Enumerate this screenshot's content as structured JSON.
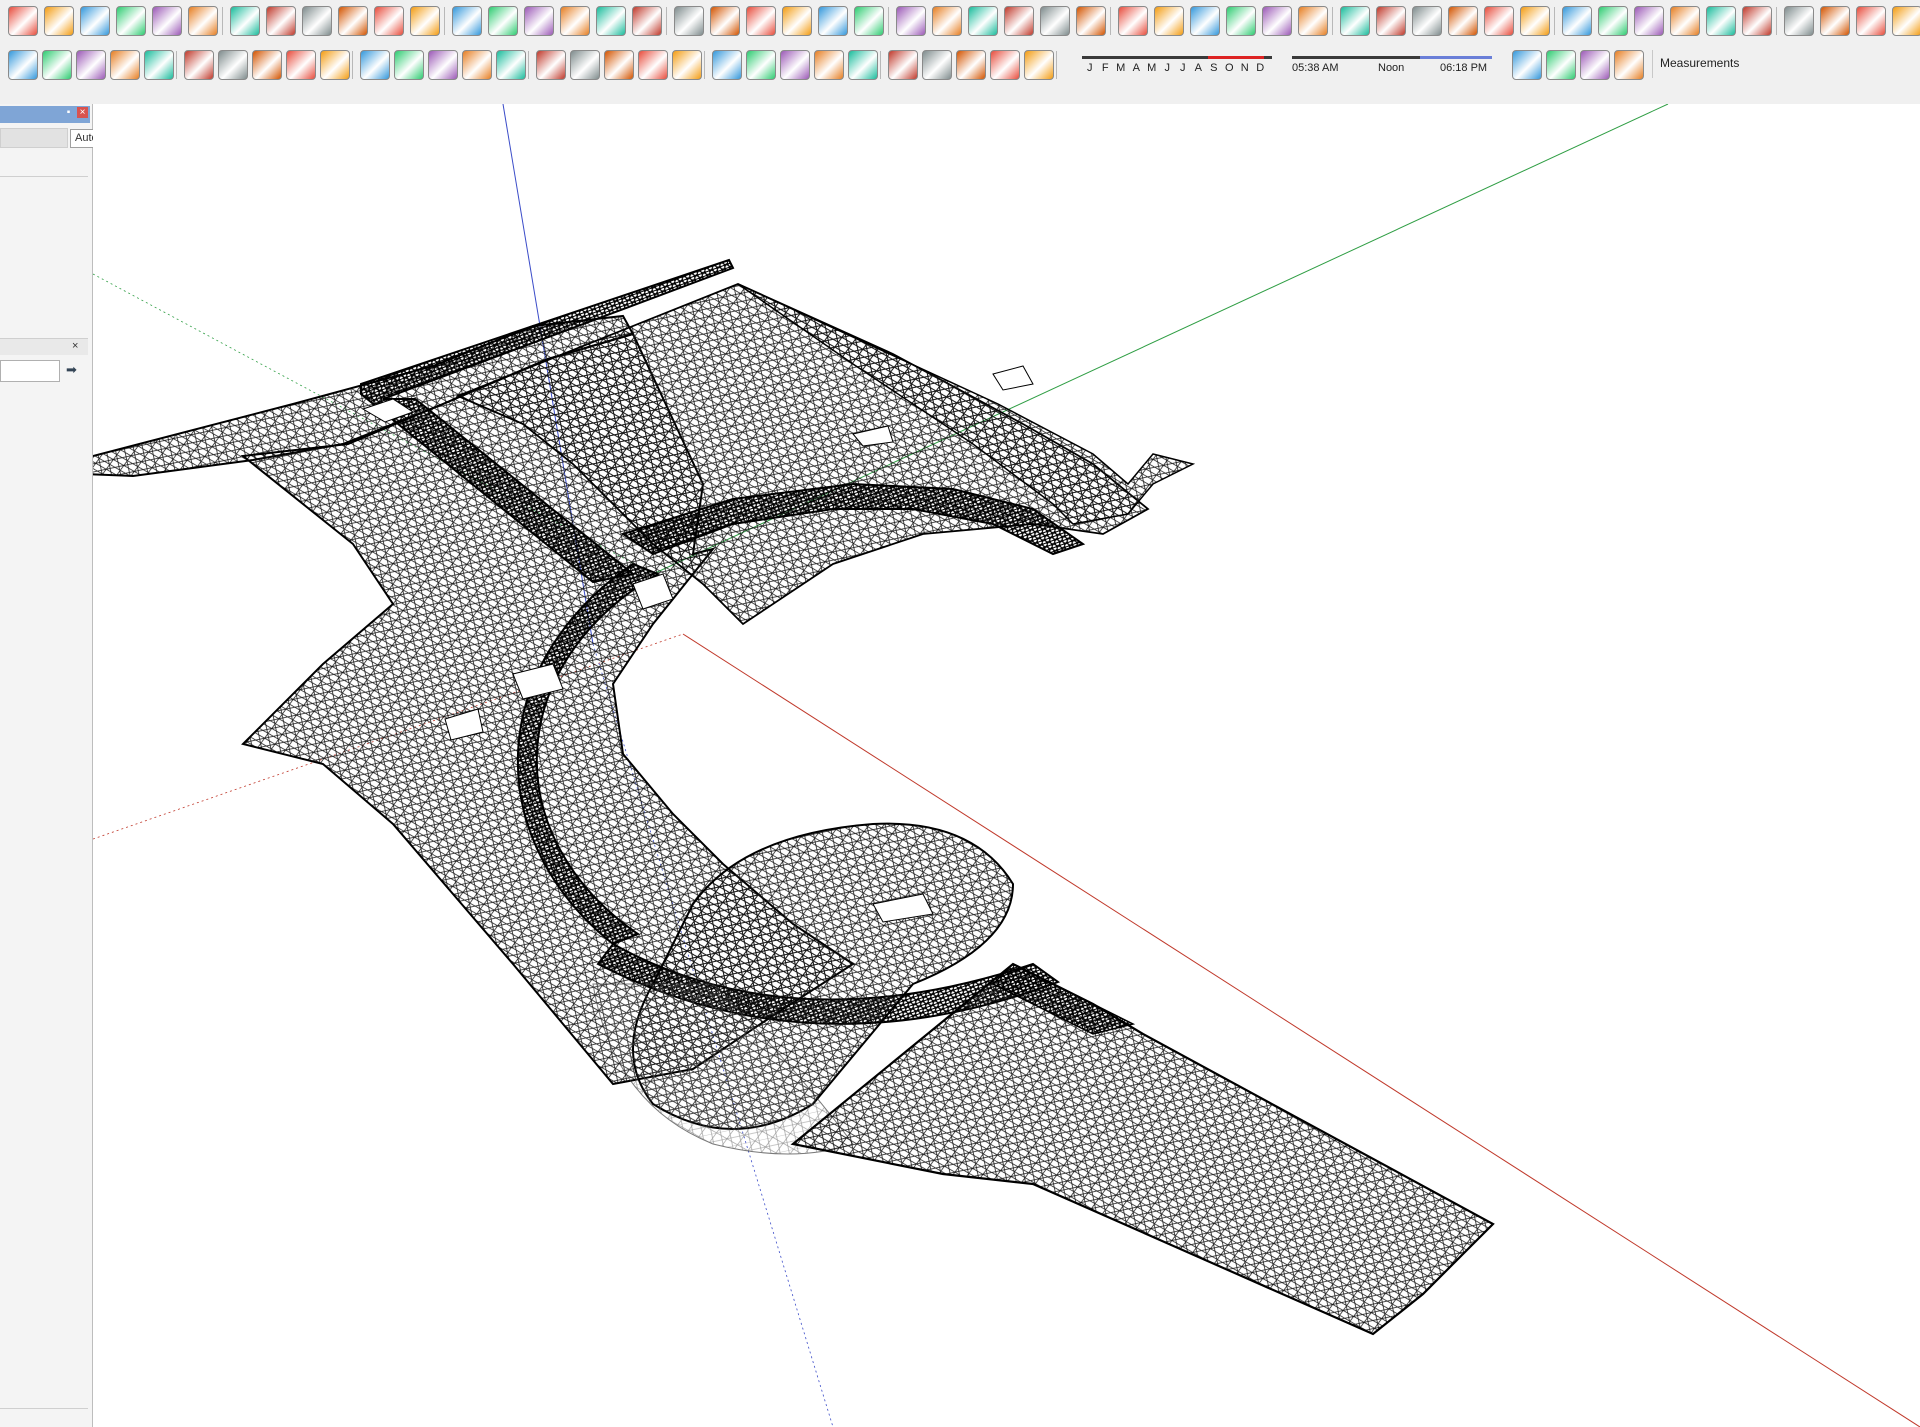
{
  "toolbar": {
    "shadow_months": [
      "J",
      "F",
      "M",
      "A",
      "M",
      "J",
      "J",
      "A",
      "S",
      "O",
      "N",
      "D"
    ],
    "shadow_time_start": "05:38 AM",
    "shadow_time_mid": "Noon",
    "shadow_time_end": "06:18 PM",
    "measurements_label": "Measurements"
  },
  "left_panel": {
    "tooltip": "Auto Hide",
    "pin_glyph": "▪",
    "close_glyph": "×",
    "search_go_glyph": "➡"
  },
  "icons": [
    "select-icon",
    "cloud-icon",
    "paint-bucket-icon",
    "move-icon",
    "rotate-icon",
    "scale-icon",
    "pushpull-icon",
    "offset-icon",
    "tape-measure-icon",
    "protractor-icon",
    "text-icon",
    "axes-icon",
    "3d-text-icon",
    "house-icon",
    "eraser-icon",
    "orbit-icon",
    "pan-icon",
    "zoom-icon",
    "zoom-extents-icon",
    "shadow-icon",
    "fog-icon",
    "section-plane-icon",
    "view-top-icon",
    "view-front-icon",
    "view-iso-icon",
    "warehouse-icon",
    "extension-icon",
    "scene-play-icon",
    "sandbox-icon",
    "smoove-icon",
    "stamp-icon",
    "drape-icon",
    "add-detail-icon",
    "flip-edge-icon"
  ],
  "colors": {
    "toolbar_bg": "#f0f0f0",
    "axis_red": "#c0392b",
    "axis_green": "#2f9e44",
    "axis_blue": "#3a4bc8",
    "mesh": "#0d0d0d"
  }
}
